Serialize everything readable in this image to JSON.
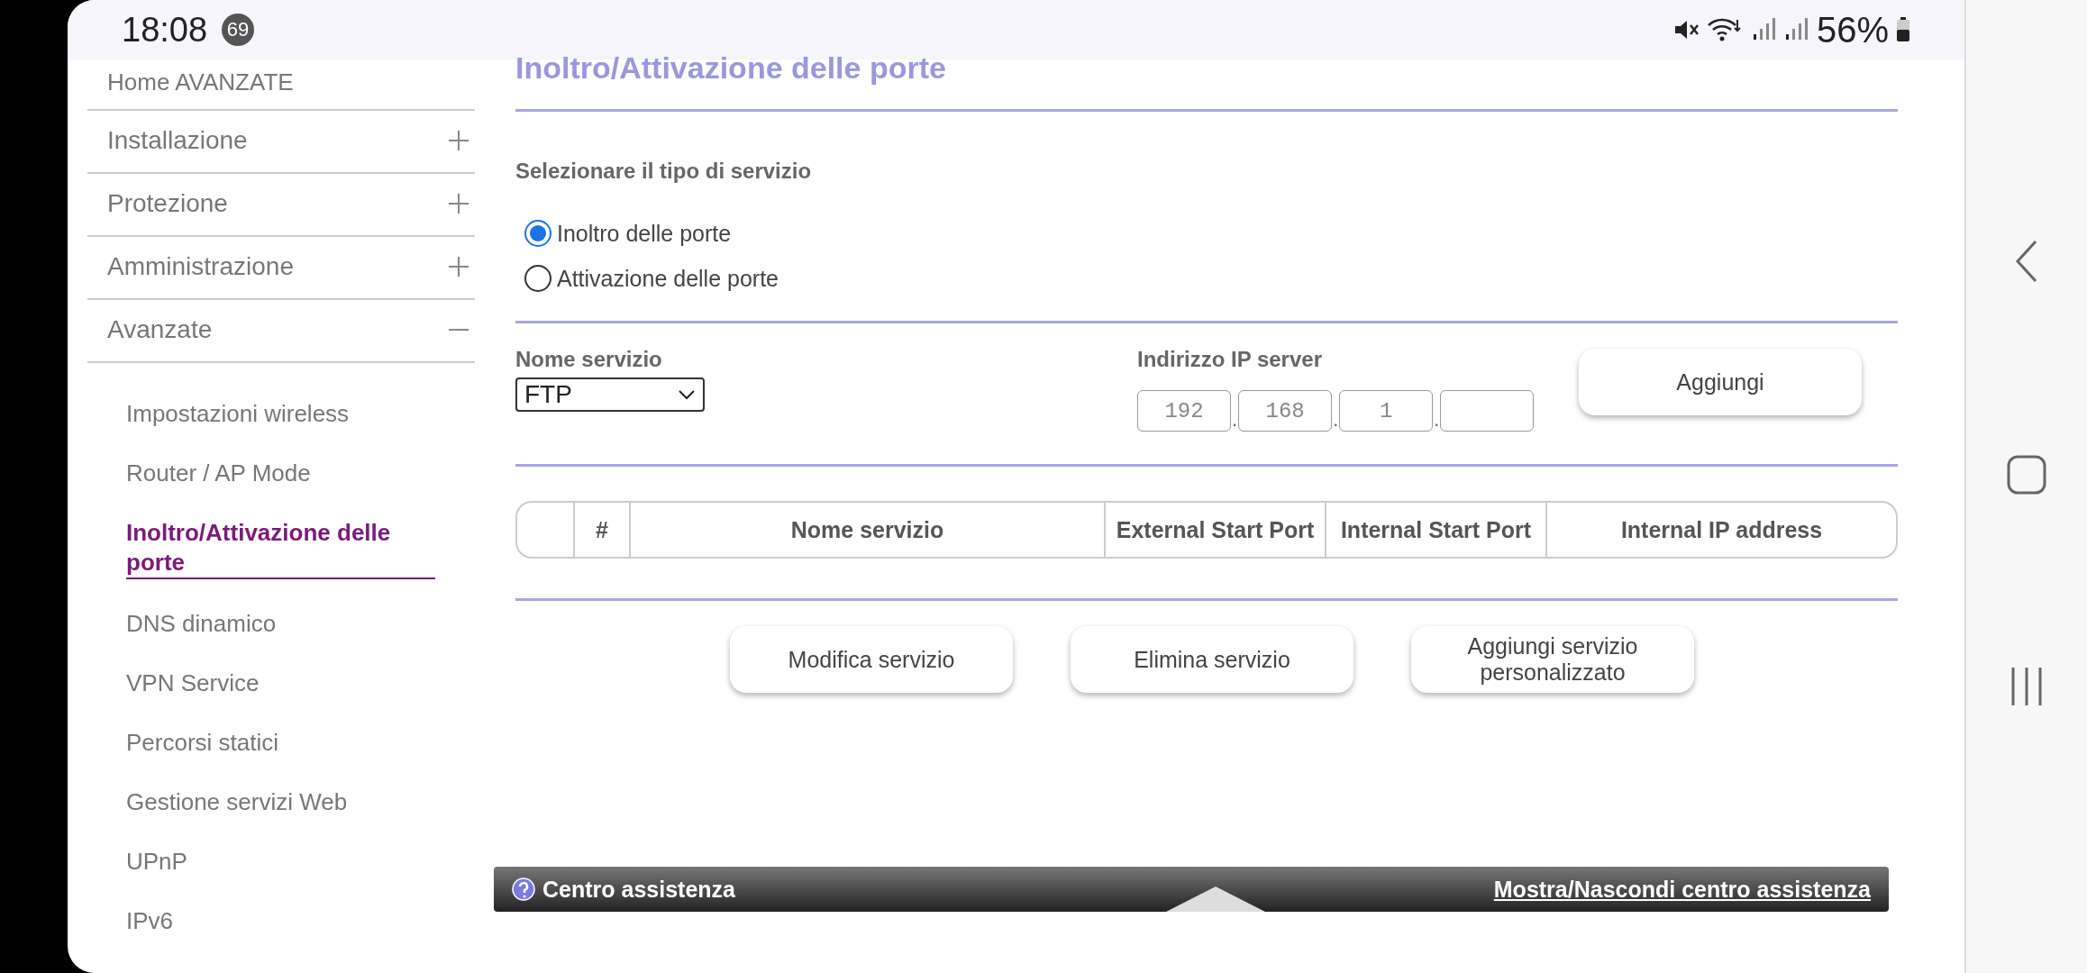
{
  "status_bar": {
    "time": "18:08",
    "notification_count": "69",
    "battery": "56%"
  },
  "sidebar": {
    "home_link": "Home AVANZATE",
    "sections": [
      {
        "label": "Installazione",
        "expanded": false
      },
      {
        "label": "Protezione",
        "expanded": false
      },
      {
        "label": "Amministrazione",
        "expanded": false
      },
      {
        "label": "Avanzate",
        "expanded": true
      }
    ],
    "subitems": [
      {
        "label": "Impostazioni wireless",
        "selected": false
      },
      {
        "label": "Router / AP Mode",
        "selected": false
      },
      {
        "label": "Inoltro/Attivazione delle porte",
        "selected": true
      },
      {
        "label": "DNS dinamico",
        "selected": false
      },
      {
        "label": "VPN Service",
        "selected": false
      },
      {
        "label": "Percorsi statici",
        "selected": false
      },
      {
        "label": "Gestione servizi Web",
        "selected": false
      },
      {
        "label": "UPnP",
        "selected": false
      },
      {
        "label": "IPv6",
        "selected": false
      }
    ]
  },
  "main": {
    "title": "Inoltro/Attivazione delle porte",
    "service_type_label": "Selezionare il tipo di servizio",
    "radios": [
      {
        "label": "Inoltro delle porte",
        "selected": true
      },
      {
        "label": "Attivazione delle porte",
        "selected": false
      }
    ],
    "service_name_label": "Nome servizio",
    "service_select": "FTP",
    "ip_label": "Indirizzo IP server",
    "ip_octets": [
      "192",
      "168",
      "1"
    ],
    "ip_separator": ".",
    "add_button": "Aggiungi",
    "table": {
      "columns": [
        "#",
        "Nome servizio",
        "External Start Port",
        "Internal Start Port",
        "Internal IP address"
      ]
    },
    "buttons": [
      "Modifica servizio",
      "Elimina servizio",
      "Aggiungi servizio personalizzato"
    ]
  },
  "help_bar": {
    "title": "Centro assistenza",
    "toggle_link": "Mostra/Nascondi centro assistenza"
  }
}
